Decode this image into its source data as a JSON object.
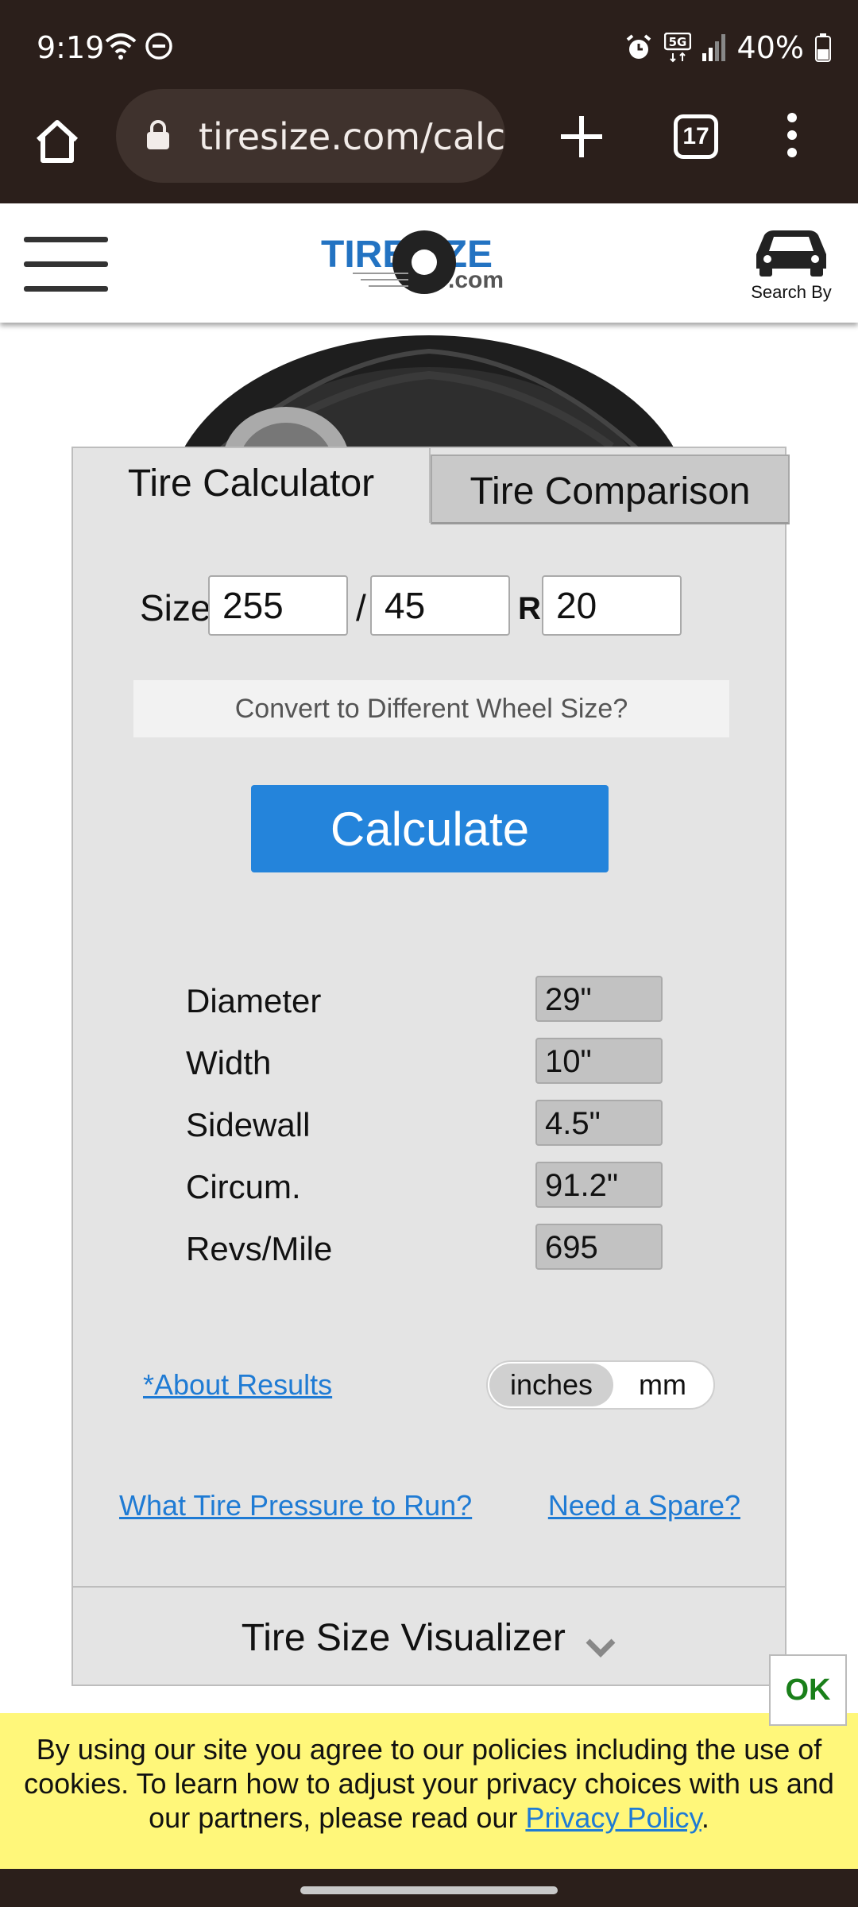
{
  "status_bar": {
    "time": "9:19",
    "battery": "40%",
    "network": "5G"
  },
  "browser": {
    "url": "tiresize.com/calc",
    "tab_count": "17"
  },
  "header": {
    "logo_text": "TIRESIZE",
    "logo_sub": ".com",
    "search_by": "Search By"
  },
  "tabs": {
    "calculator": "Tire Calculator",
    "comparison": "Tire Comparison"
  },
  "size": {
    "label": "Size",
    "width": "255",
    "aspect": "45",
    "rim": "20",
    "sep": "/",
    "r": "R"
  },
  "convert_label": "Convert to Different Wheel Size?",
  "calculate_label": "Calculate",
  "results": [
    {
      "label": "Diameter",
      "value": "29\""
    },
    {
      "label": "Width",
      "value": "10\""
    },
    {
      "label": "Sidewall",
      "value": "4.5\""
    },
    {
      "label": "Circum.",
      "value": "91.2\""
    },
    {
      "label": "Revs/Mile",
      "value": "695"
    }
  ],
  "about_results": "*About Results",
  "units": {
    "inches": "inches",
    "mm": "mm",
    "selected": "inches"
  },
  "links": {
    "pressure": "What Tire Pressure to Run?",
    "spare": "Need a Spare?"
  },
  "visualizer": "Tire Size Visualizer",
  "cookie": {
    "text": "By using our site you agree to our policies including the use of cookies. To learn how to adjust your privacy choices with us and our partners, please read our ",
    "link": "Privacy Policy",
    "end": ".",
    "ok": "OK"
  },
  "colors": {
    "accent": "#2484db",
    "link": "#1f7bd4",
    "banner": "#fff77a",
    "chrome": "#2b1f1b"
  }
}
